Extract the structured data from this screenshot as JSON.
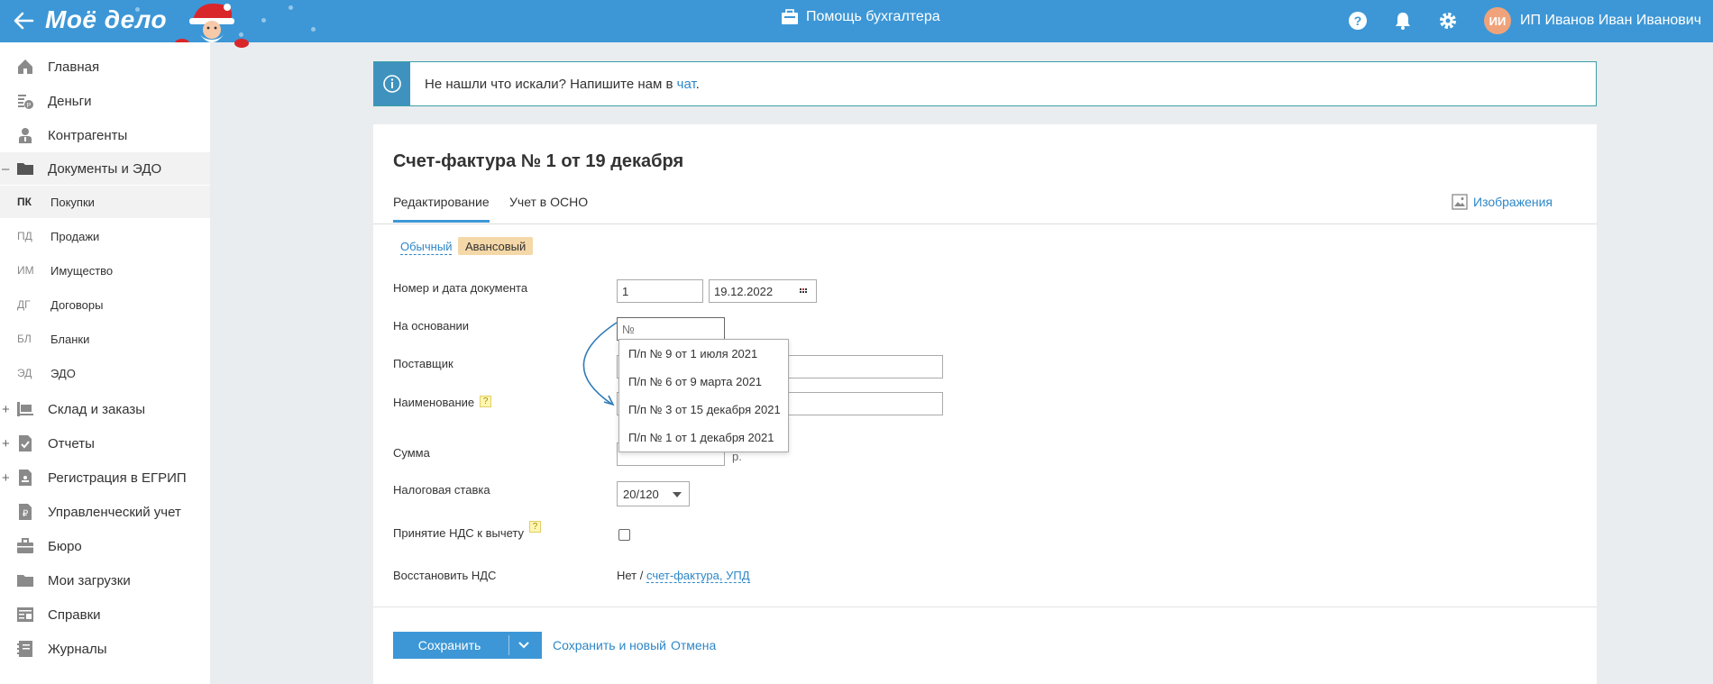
{
  "header": {
    "logo": "Моё дело",
    "helper": "Помощь бухгалтера",
    "avatar_initials": "ИИ",
    "user_name": "ИП Иванов Иван Иванович",
    "bg_color": "#3d97d6"
  },
  "sidebar": {
    "items": [
      {
        "label": "Главная",
        "icon": "home-icon"
      },
      {
        "label": "Деньги",
        "icon": "money-icon"
      },
      {
        "label": "Контрагенты",
        "icon": "contractors-icon"
      },
      {
        "label": "Документы и ЭДО",
        "icon": "folder-icon",
        "marker": "–"
      },
      {
        "label": "Склад и заказы",
        "icon": "warehouse-icon",
        "marker": "+"
      },
      {
        "label": "Отчеты",
        "icon": "reports-icon",
        "marker": "+"
      },
      {
        "label": "Регистрация в ЕГРИП",
        "icon": "registration-icon",
        "marker": "+"
      },
      {
        "label": "Управленческий учет",
        "icon": "management-icon"
      },
      {
        "label": "Бюро",
        "icon": "briefcase-icon"
      },
      {
        "label": "Мои загрузки",
        "icon": "downloads-icon"
      },
      {
        "label": "Справки",
        "icon": "certificates-icon"
      },
      {
        "label": "Журналы",
        "icon": "journals-icon"
      }
    ],
    "subitems": [
      {
        "abbr": "ПК",
        "label": "Покупки"
      },
      {
        "abbr": "ПД",
        "label": "Продажи"
      },
      {
        "abbr": "ИМ",
        "label": "Имущество"
      },
      {
        "abbr": "ДГ",
        "label": "Договоры"
      },
      {
        "abbr": "БЛ",
        "label": "Бланки"
      },
      {
        "abbr": "ЭД",
        "label": "ЭДО"
      }
    ]
  },
  "info": {
    "text": "Не нашли что искали? Напишите нам в ",
    "link": "чат",
    "end": "."
  },
  "form": {
    "title": "Счет-фактура № 1 от 19 декабря",
    "tabs": [
      "Редактирование",
      "Учет в ОСНО"
    ],
    "images_link": "Изображения",
    "type_plain": "Обычный",
    "type_advance": "Авансовый",
    "labels": {
      "number_date": "Номер и дата документа",
      "basis": "На основании",
      "supplier": "Поставщик",
      "name": "Наименование",
      "sum": "Сумма",
      "tax_rate": "Налоговая ставка",
      "vat_deduction": "Принятие НДС к вычету",
      "restore_vat": "Восстановить НДС"
    },
    "help_mark": "?",
    "number_value": "1",
    "date_value": "19.12.2022",
    "basis_placeholder": "№",
    "currency": "р.",
    "tax_rate_value": "20/120",
    "restore_prefix": "Нет / ",
    "restore_link": "счет-фактура, УПД",
    "dropdown_options": [
      "П/п № 9 от 1 июля 2021",
      "П/п № 6 от 9 марта 2021",
      "П/п № 3 от 15 декабря 2021",
      "П/п № 1 от 1 декабря 2021"
    ]
  },
  "footer": {
    "save": "Сохранить",
    "save_new": "Сохранить и новый",
    "cancel": "Отмена"
  }
}
